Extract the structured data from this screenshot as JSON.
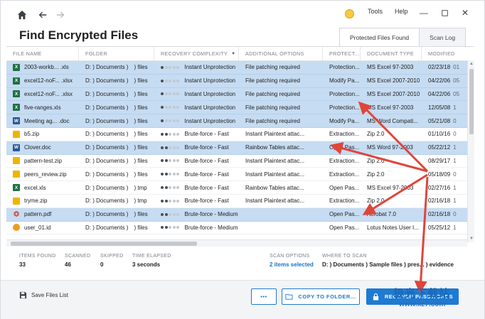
{
  "window": {
    "menu": [
      "Tools",
      "Help"
    ],
    "title": "Find Encrypted Files"
  },
  "tabs": [
    {
      "label": "Protected Files Found",
      "active": true
    },
    {
      "label": "Scan Log",
      "active": false
    }
  ],
  "columns": [
    "FILE NAME",
    "FOLDER",
    "RECOVERY COMPLEXITY",
    "ADDITIONAL OPTIONS",
    "PROTECT...",
    "DOCUMENT TYPE",
    "MODIFIED"
  ],
  "sort_indicator": "▼",
  "rows": [
    {
      "icon": "excel",
      "name": "2003-workb... .xls",
      "folder": "D: ) Documents )",
      "folder_end": ") files",
      "level": 1,
      "complexity": "Instant Unprotection",
      "options": "File patching required",
      "protect": "Protection...",
      "type": "MS Excel 97-2003",
      "modified": "02/23/18",
      "mod_tail": "01",
      "selected": true
    },
    {
      "icon": "excel",
      "name": "excel12-noF... .xlsx",
      "folder": "D: ) Documents )",
      "folder_end": ") files",
      "level": 1,
      "complexity": "Instant Unprotection",
      "options": "File patching required",
      "protect": "Modify Pa...",
      "type": "MS Excel 2007-2010",
      "modified": "04/22/06",
      "mod_tail": "05",
      "selected": true
    },
    {
      "icon": "excel",
      "name": "excel12-noF... .xlsx",
      "folder": "D: ) Documents )",
      "folder_end": ") files",
      "level": 1,
      "complexity": "Instant Unprotection",
      "options": "File patching required",
      "protect": "Protection...",
      "type": "MS Excel 2007-2010",
      "modified": "04/22/06",
      "mod_tail": "05",
      "selected": true
    },
    {
      "icon": "excel",
      "name": "five-ranges.xls",
      "folder": "D: ) Documents )",
      "folder_end": ") files",
      "level": 1,
      "complexity": "Instant Unprotection",
      "options": "File patching required",
      "protect": "Protection...",
      "type": "MS Excel 97-2003",
      "modified": "12/05/08",
      "mod_tail": "1",
      "selected": true
    },
    {
      "icon": "word",
      "name": "Meeting ag... .doc",
      "folder": "D: ) Documents )",
      "folder_end": ") files",
      "level": 1,
      "complexity": "Instant Unprotection",
      "options": "File patching required",
      "protect": "Modify Pa...",
      "type": "MS Word Compati...",
      "modified": "05/21/08",
      "mod_tail": "0",
      "selected": true
    },
    {
      "icon": "zip",
      "name": "b5.zip",
      "folder": "D: ) Documents )",
      "folder_end": ") files",
      "level": 2,
      "complexity": "Brute-force - Fast",
      "options": "Instant Plaintext attac...",
      "protect": "Extraction...",
      "type": "Zip 2.0",
      "modified": "01/10/16",
      "mod_tail": "0",
      "selected": false
    },
    {
      "icon": "word",
      "name": "Clover.doc",
      "folder": "D: ) Documents )",
      "folder_end": ") files",
      "level": 2,
      "complexity": "Brute-force - Fast",
      "options": "Rainbow Tables attac...",
      "protect": "Open Pas...",
      "type": "MS Word 97-2003",
      "modified": "05/22/12",
      "mod_tail": "1",
      "selected": true
    },
    {
      "icon": "zip",
      "name": "pattern-test.zip",
      "folder": "D: ) Documents )",
      "folder_end": ") files",
      "level": 2,
      "complexity": "Brute-force - Fast",
      "options": "Instant Plaintext attac...",
      "protect": "Extraction...",
      "type": "Zip 2.0",
      "modified": "08/29/17",
      "mod_tail": "1",
      "selected": false
    },
    {
      "icon": "zip",
      "name": "peers_review.zip",
      "folder": "D: ) Documents )",
      "folder_end": ") files",
      "level": 2,
      "complexity": "Brute-force - Fast",
      "options": "Instant Plaintext attac...",
      "protect": "Extraction...",
      "type": "Zip 2.0",
      "modified": "05/18/09",
      "mod_tail": "0",
      "selected": false
    },
    {
      "icon": "excel",
      "name": "excel.xls",
      "folder": "D: ) Documents )",
      "folder_end": ") tmp",
      "level": 2,
      "complexity": "Brute-force - Fast",
      "options": "Rainbow Tables attac...",
      "protect": "Open Pas...",
      "type": "MS Excel 97-2003",
      "modified": "02/27/16",
      "mod_tail": "1",
      "selected": false
    },
    {
      "icon": "zip",
      "name": "tryme.zip",
      "folder": "D: ) Documents )",
      "folder_end": ") tmp",
      "level": 2,
      "complexity": "Brute-force - Fast",
      "options": "Instant Plaintext attac...",
      "protect": "Extraction...",
      "type": "Zip 2.0",
      "modified": "02/16/18",
      "mod_tail": "1",
      "selected": false
    },
    {
      "icon": "pdf",
      "name": "pattern.pdf",
      "folder": "D: ) Documents )",
      "folder_end": ") files",
      "level": 2,
      "complexity": "Brute-force - Medium",
      "options": "",
      "protect": "Open Pas...",
      "type": "Acrobat 7.0",
      "modified": "02/16/18",
      "mod_tail": "0",
      "selected": true
    },
    {
      "icon": "lotus",
      "name": "user_01.id",
      "folder": "D: ) Documents )",
      "folder_end": ") files",
      "level": 2,
      "complexity": "Brute-force - Medium",
      "options": "",
      "protect": "Open Pas...",
      "type": "Lotus Notes User I...",
      "modified": "05/25/12",
      "mod_tail": "1",
      "selected": false
    }
  ],
  "stats": [
    {
      "label": "ITEMS FOUND",
      "value": "33"
    },
    {
      "label": "SCANNED",
      "value": "46"
    },
    {
      "label": "SKIPPED",
      "value": "0"
    },
    {
      "label": "TIME ELAPSED",
      "value": "3 seconds"
    },
    {
      "label": "SCAN OPTIONS",
      "value": "2 items selected"
    },
    {
      "label": "WHERE TO SCAN",
      "value": "D: ) Documents ) Sample files ) pres... ) evidence"
    }
  ],
  "bottom": {
    "save_label": "Save Files List",
    "more_label": "•••",
    "copy_label": "COPY TO FOLDER...",
    "recover_label": "RECOVER PASSWORDS"
  },
  "watermark": {
    "line1": "极光下载站",
    "line2": "www.xz7.com"
  },
  "colors": {
    "accent": "#1e7ad2",
    "selection": "#c6dcf2",
    "arrow": "#e0453a"
  },
  "icons": [
    "home-icon",
    "back-arrow-icon",
    "forward-arrow-icon",
    "smiley-icon",
    "minimize-icon",
    "maximize-icon",
    "close-icon",
    "save-icon",
    "folder-icon",
    "lock-icon"
  ]
}
